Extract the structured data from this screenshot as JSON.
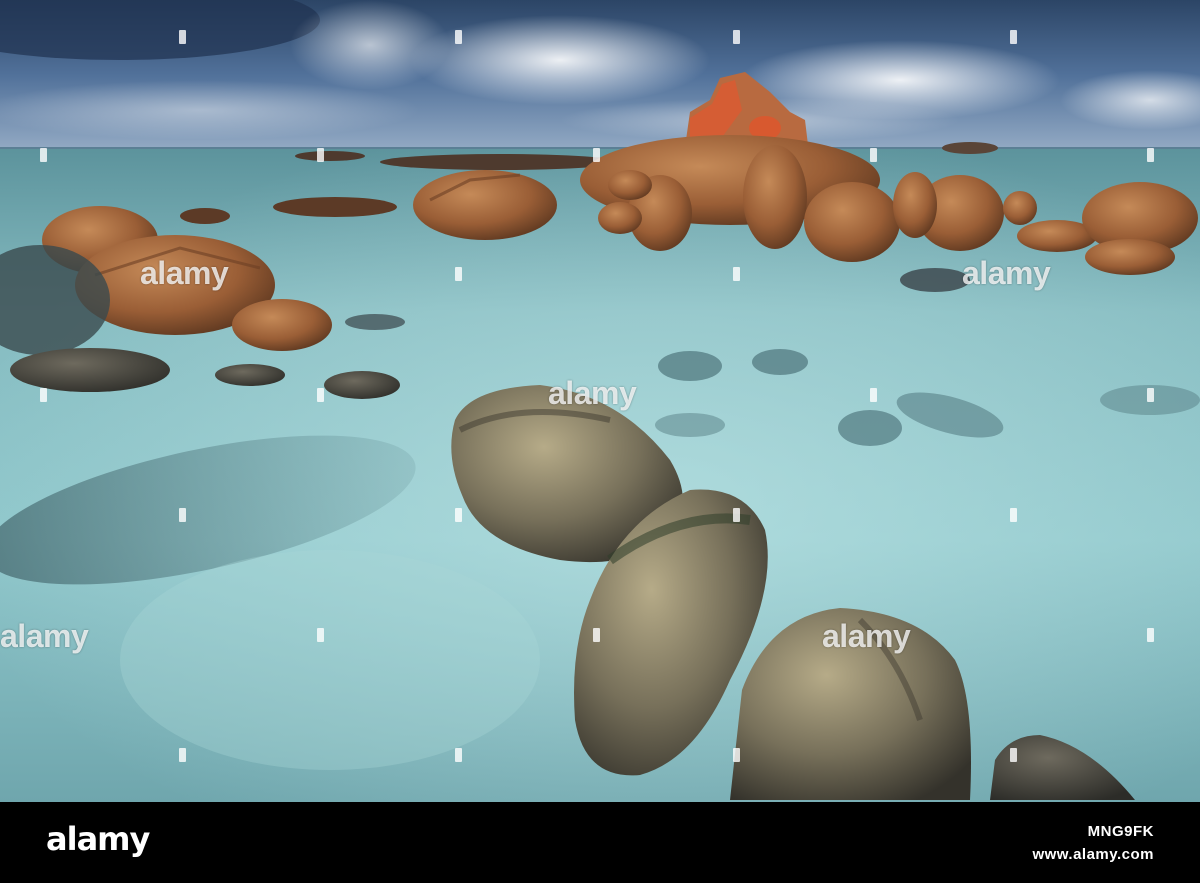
{
  "watermark": {
    "text": "alamy"
  },
  "footer": {
    "logo": "alamy",
    "image_id": "MNG9FK",
    "site": "www.alamy.com"
  },
  "colors": {
    "sky_top": "#3f5f86",
    "sea": "#8fc9cc",
    "rock_orange": "#a9683c",
    "lichen": "#e0562c",
    "footer_bg": "#000000"
  }
}
